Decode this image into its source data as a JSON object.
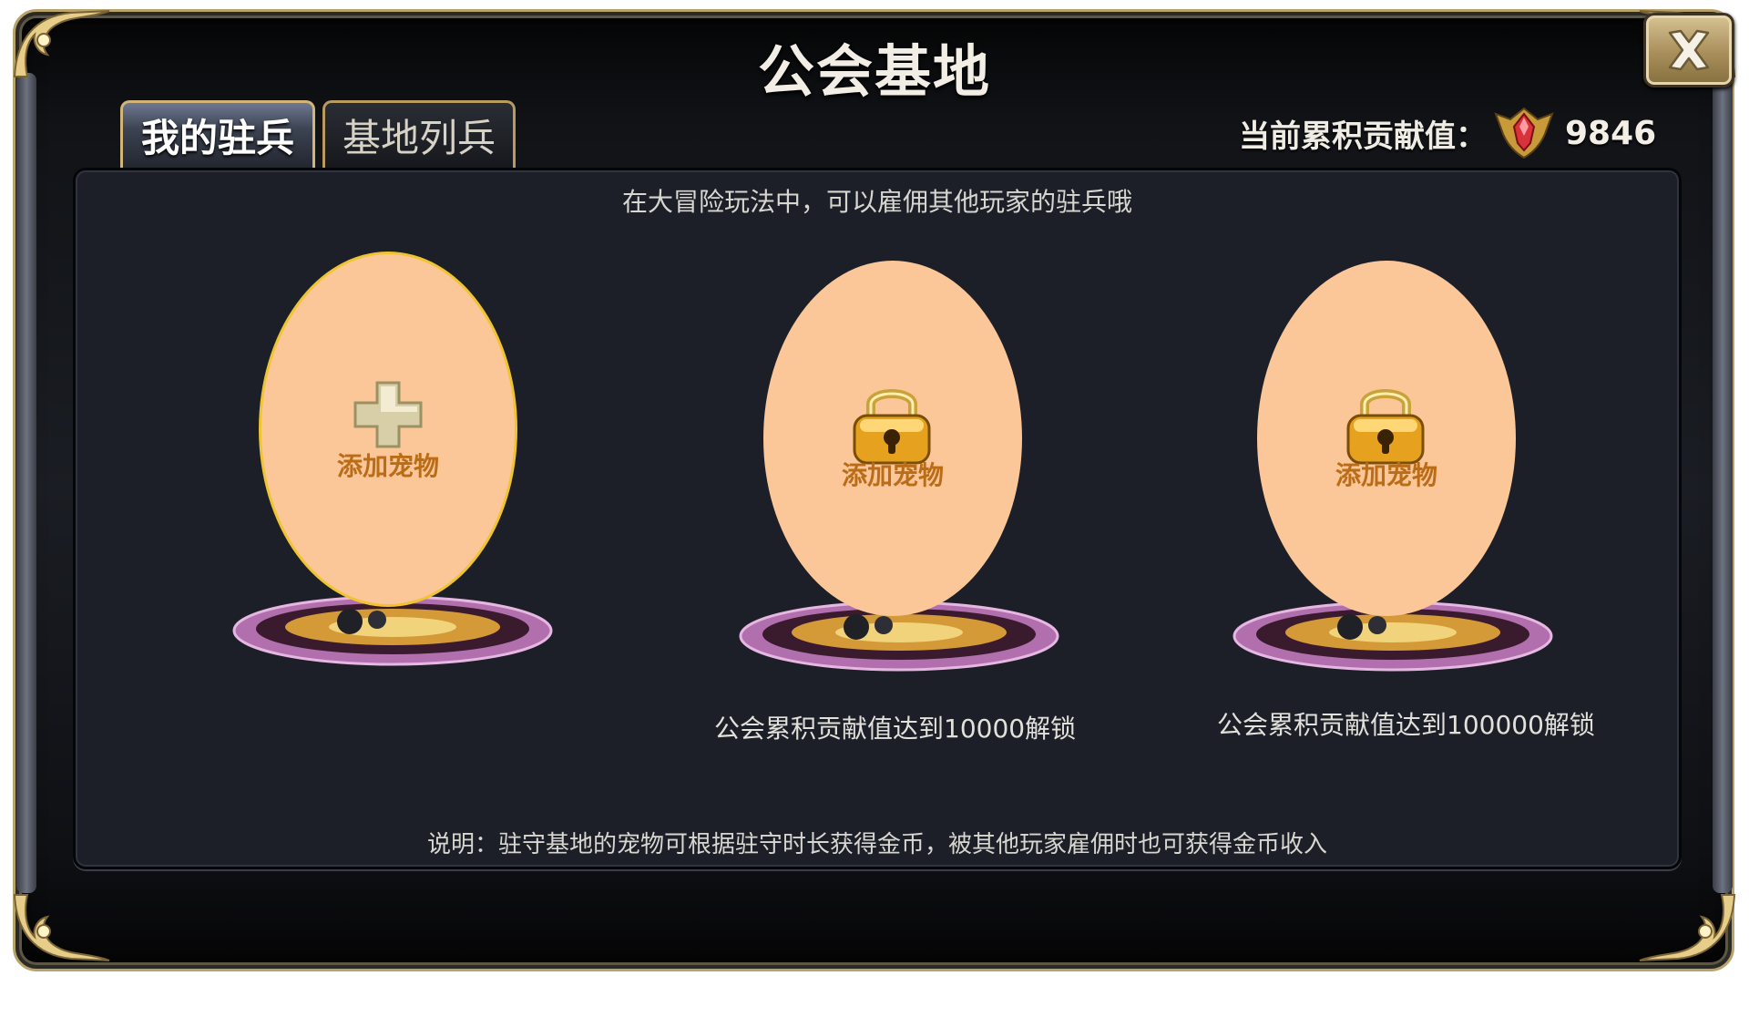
{
  "window": {
    "title": "公会基地",
    "close_icon": "close-x-icon"
  },
  "tabs": [
    {
      "label": "我的驻兵",
      "active": true
    },
    {
      "label": "基地列兵",
      "active": false
    }
  ],
  "contribution": {
    "label": "当前累积贡献值：",
    "icon": "red-gem-shield-icon",
    "value": "9846"
  },
  "panel": {
    "hint": "在大冒险玩法中，可以雇佣其他玩家的驻兵哦",
    "note": "说明：驻守基地的宠物可根据驻守时长获得金币，被其他玩家雇佣时也可获得金币收入"
  },
  "slots": [
    {
      "label": "添加宠物",
      "state": "open",
      "icon": "plus-icon",
      "unlock_text": ""
    },
    {
      "label": "添加宠物",
      "state": "locked",
      "icon": "padlock-icon",
      "unlock_text": "公会累积贡献值达到10000解锁"
    },
    {
      "label": "添加宠物",
      "state": "locked",
      "icon": "padlock-icon",
      "unlock_text": "公会累积贡献值达到100000解锁"
    }
  ],
  "colors": {
    "frame_gold": "#b9a36d",
    "panel_bg": "#1c1f27",
    "egg_fill": "#fbc799",
    "label_orange": "#bb6c17"
  }
}
